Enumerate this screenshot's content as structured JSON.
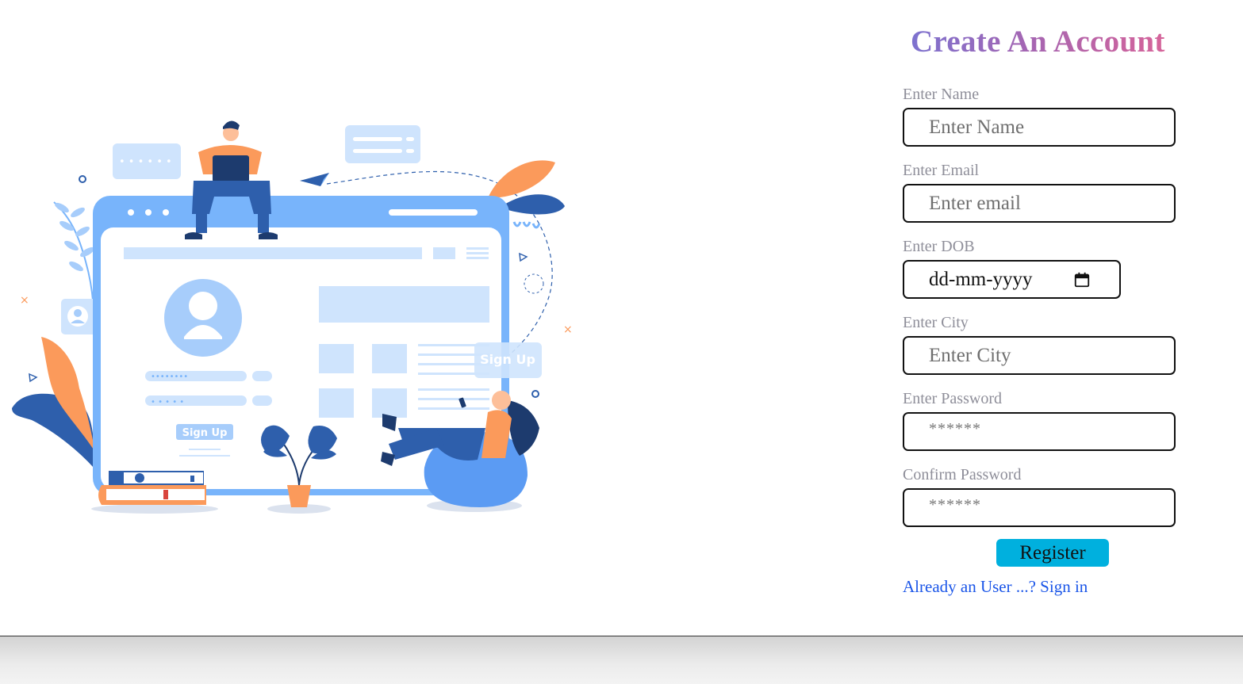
{
  "form": {
    "title": "Create An Account",
    "fields": [
      {
        "label": "Enter Name",
        "placeholder": "Enter Name"
      },
      {
        "label": "Enter Email",
        "placeholder": "Enter email"
      },
      {
        "label": "Enter DOB",
        "placeholder": "dd-mm-yyyy"
      },
      {
        "label": "Enter City",
        "placeholder": "Enter City"
      },
      {
        "label": "Enter Password",
        "placeholder": "******"
      },
      {
        "label": "Confirm Password",
        "placeholder": "******"
      }
    ],
    "register_label": "Register",
    "signin_link": "Already an User ...? Sign in"
  },
  "illustration": {
    "sign_up_button": "Sign Up",
    "sign_up_tag": "Sign Up",
    "password_dots_1": "••••••••",
    "password_dots_2": "• • • • •",
    "chat_dots": "• • • • • •"
  },
  "icons": {
    "calendar": "calendar-icon"
  },
  "colors": {
    "title_gradient_start": "#7d72cf",
    "title_gradient_end": "#d6649a",
    "label": "#8e8e99",
    "register_button": "#00b0de",
    "link": "#1a55e8",
    "illustration_blue": "#78b4fb",
    "illustration_light_blue": "#cfe4fd",
    "illustration_dark_blue": "#2e5fac",
    "illustration_orange": "#fb9a5b"
  }
}
